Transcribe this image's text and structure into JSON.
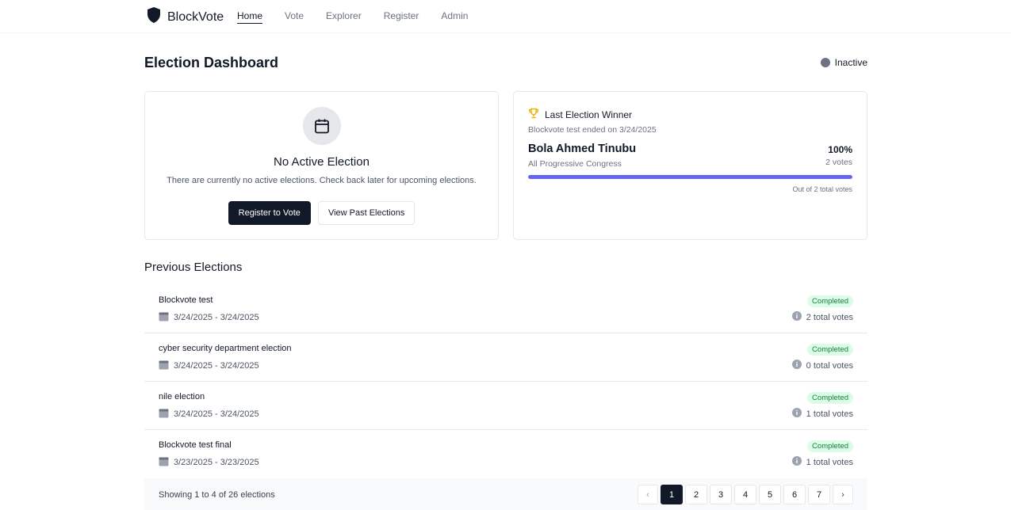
{
  "nav": {
    "brand": "BlockVote",
    "links": [
      "Home",
      "Vote",
      "Explorer",
      "Register",
      "Admin"
    ],
    "active": "Home"
  },
  "header": {
    "title": "Election Dashboard",
    "status": "Inactive",
    "status_color": "#6b7280"
  },
  "no_active": {
    "icon": "calendar-icon",
    "title": "No Active Election",
    "text": "There are currently no active elections. Check back later for upcoming elections.",
    "primary_button": "Register to Vote",
    "secondary_button": "View Past Elections"
  },
  "winner": {
    "icon": "trophy-icon",
    "heading": "Last Election Winner",
    "subtitle": "Blockvote test ended on 3/24/2025",
    "name": "Bola Ahmed Tinubu",
    "party": "All Progressive Congress",
    "percent": "100%",
    "percent_value": 1.0,
    "votes": "2 votes",
    "caption": "Out of 2 total votes",
    "bar_color": "#6366f1"
  },
  "previous": {
    "title": "Previous Elections",
    "items": [
      {
        "name": "Blockvote test",
        "dates": "3/24/2025 - 3/24/2025",
        "status": "Completed",
        "votes": "2 total votes"
      },
      {
        "name": "cyber security department election",
        "dates": "3/24/2025 - 3/24/2025",
        "status": "Completed",
        "votes": "0 total votes"
      },
      {
        "name": "nile election",
        "dates": "3/24/2025 - 3/24/2025",
        "status": "Completed",
        "votes": "1 total votes"
      },
      {
        "name": "Blockvote test final",
        "dates": "3/23/2025 - 3/23/2025",
        "status": "Completed",
        "votes": "1 total votes"
      }
    ],
    "footer": "Showing 1 to 4 of 26 elections",
    "pages": [
      "1",
      "2",
      "3",
      "4",
      "5",
      "6",
      "7"
    ],
    "current_page": "1"
  }
}
